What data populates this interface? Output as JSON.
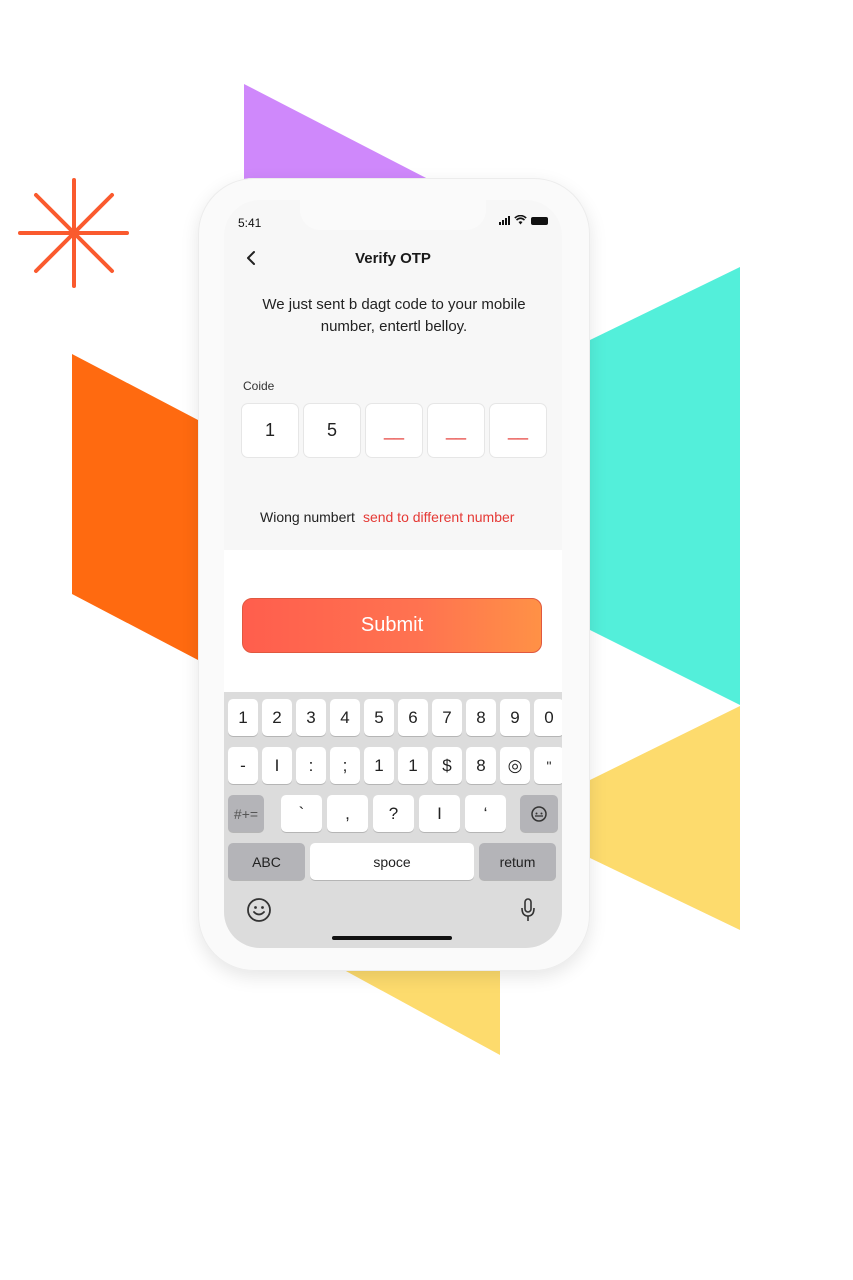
{
  "colors": {
    "accent": "#ff6a4d",
    "purple": "#cf88fb",
    "orange": "#ff6a10",
    "teal": "#53efda",
    "yellow": "#fddb6d",
    "error_red": "#e53935"
  },
  "status_bar": {
    "time": "5:41",
    "icons": [
      "signal-icon",
      "wifi-icon",
      "battery-icon"
    ]
  },
  "header": {
    "back_icon": "chevron-left-icon",
    "title": "Verify OTP"
  },
  "instructions": "We just sent b dagt code to your mobile number, entertl belloy.",
  "code": {
    "label": "Coide",
    "digits": [
      "1",
      "5",
      "__",
      "__",
      "__"
    ]
  },
  "wrong_number": {
    "text": "Wiong numbert",
    "link": "send to different number"
  },
  "submit": {
    "label": "Submit"
  },
  "keyboard": {
    "row1": [
      "1",
      "2",
      "3",
      "4",
      "5",
      "6",
      "7",
      "8",
      "9",
      "0"
    ],
    "row2": [
      "-",
      "I",
      ":",
      ";",
      "1",
      "1",
      "$",
      "8",
      "◎",
      "\""
    ],
    "row3": [
      "#+=",
      "`",
      ",",
      "?",
      "I",
      "‘",
      "⊖"
    ],
    "row4": [
      "ABC",
      "spoce",
      "retum"
    ],
    "bottom_icons": [
      "emoji-icon",
      "microphone-icon"
    ]
  }
}
